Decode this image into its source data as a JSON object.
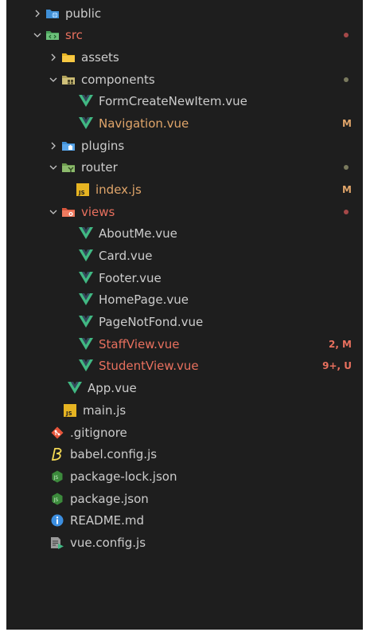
{
  "explorer": {
    "items": [
      {
        "label": "public",
        "chevron": "right",
        "icon": "folder-public-icon",
        "labelColor": "normal",
        "badge": ""
      },
      {
        "label": "src",
        "chevron": "down",
        "icon": "folder-src-icon",
        "labelColor": "red",
        "dot": "#a54848",
        "badge": ""
      },
      {
        "label": "assets",
        "chevron": "right",
        "icon": "folder-assets-icon",
        "labelColor": "normal",
        "badge": ""
      },
      {
        "label": "components",
        "chevron": "down",
        "icon": "folder-components-icon",
        "labelColor": "normal",
        "dot": "#7a7a5e",
        "badge": ""
      },
      {
        "label": "FormCreateNewItem.vue",
        "icon": "vue-icon",
        "labelColor": "normal",
        "badge": ""
      },
      {
        "label": "Navigation.vue",
        "icon": "vue-icon",
        "labelColor": "orange",
        "badge": "M",
        "badgeColor": "#e0a56a"
      },
      {
        "label": "plugins",
        "chevron": "right",
        "icon": "folder-plugins-icon",
        "labelColor": "normal",
        "badge": ""
      },
      {
        "label": "router",
        "chevron": "down",
        "icon": "folder-router-icon",
        "labelColor": "normal",
        "dot": "#7a7a5e",
        "badge": ""
      },
      {
        "label": "index.js",
        "icon": "js-icon",
        "labelColor": "orange",
        "badge": "M",
        "badgeColor": "#e0a56a"
      },
      {
        "label": "views",
        "chevron": "down",
        "icon": "folder-views-icon",
        "labelColor": "red",
        "dot": "#a54848",
        "badge": ""
      },
      {
        "label": "AboutMe.vue",
        "icon": "vue-icon",
        "labelColor": "normal",
        "badge": ""
      },
      {
        "label": "Card.vue",
        "icon": "vue-icon",
        "labelColor": "normal",
        "badge": ""
      },
      {
        "label": "Footer.vue",
        "icon": "vue-icon",
        "labelColor": "normal",
        "badge": ""
      },
      {
        "label": "HomePage.vue",
        "icon": "vue-icon",
        "labelColor": "normal",
        "badge": ""
      },
      {
        "label": "PageNotFond.vue",
        "icon": "vue-icon",
        "labelColor": "normal",
        "badge": ""
      },
      {
        "label": "StaffView.vue",
        "icon": "vue-icon",
        "labelColor": "red",
        "badge": "2, M",
        "badgeColor": "#e8705e"
      },
      {
        "label": "StudentView.vue",
        "icon": "vue-icon",
        "labelColor": "red",
        "badge": "9+, U",
        "badgeColor": "#e8705e"
      },
      {
        "label": "App.vue",
        "icon": "vue-icon",
        "labelColor": "normal",
        "badge": ""
      },
      {
        "label": "main.js",
        "icon": "js-icon",
        "labelColor": "normal",
        "badge": ""
      },
      {
        "label": ".gitignore",
        "icon": "git-icon",
        "labelColor": "normal",
        "badge": ""
      },
      {
        "label": "babel.config.js",
        "icon": "babel-icon",
        "labelColor": "normal",
        "badge": ""
      },
      {
        "label": "package-lock.json",
        "icon": "node-icon",
        "labelColor": "normal",
        "badge": ""
      },
      {
        "label": "package.json",
        "icon": "node-icon",
        "labelColor": "normal",
        "badge": ""
      },
      {
        "label": "README.md",
        "icon": "info-icon",
        "labelColor": "normal",
        "badge": ""
      },
      {
        "label": "vue.config.js",
        "icon": "config-file-icon",
        "labelColor": "normal",
        "badge": ""
      }
    ]
  },
  "colors": {
    "background": "#1e1e1e",
    "text": "#cccccc",
    "modified": "#e0a56a",
    "error": "#e8705e",
    "vue": "#41b883"
  }
}
